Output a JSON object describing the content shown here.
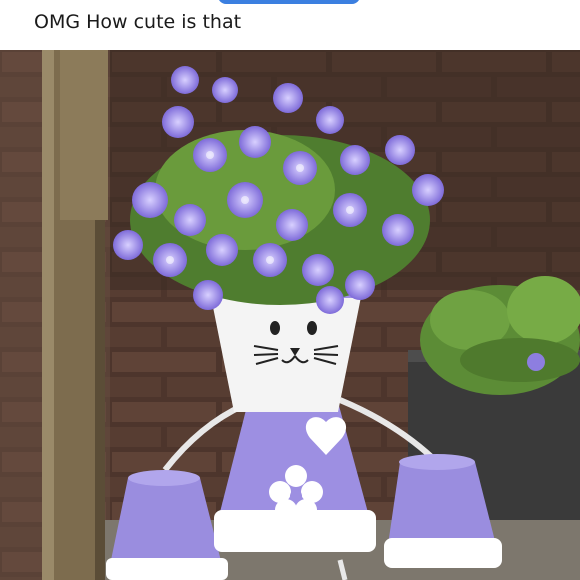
{
  "post": {
    "caption": "OMG How cute is that",
    "header_button_color": "#3b7fe0"
  },
  "photo": {
    "subject": "clay pot cat figure with purple bellflowers",
    "colors": {
      "pot_purple": "#9c8fe0",
      "pot_white": "#ffffff",
      "flower_purple": "#8f7fe6",
      "brick": "#5b4034",
      "wood": "#7a6a4c",
      "foliage": "#5f8f3a"
    }
  }
}
